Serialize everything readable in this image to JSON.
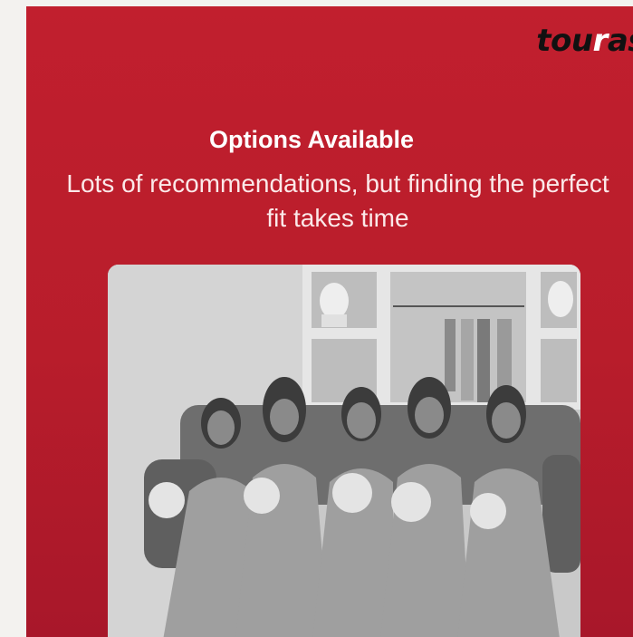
{
  "brand": {
    "name": "tou",
    "accent": "r",
    "suffix": "as"
  },
  "heading": {
    "title": "Options Available",
    "subtitle": "Lots of recommendations, but finding the perfect fit takes time"
  },
  "colors": {
    "card_red": "#c11f2e",
    "brand_text": "#111111"
  },
  "photo": {
    "description_icon": "group-photo-image"
  }
}
